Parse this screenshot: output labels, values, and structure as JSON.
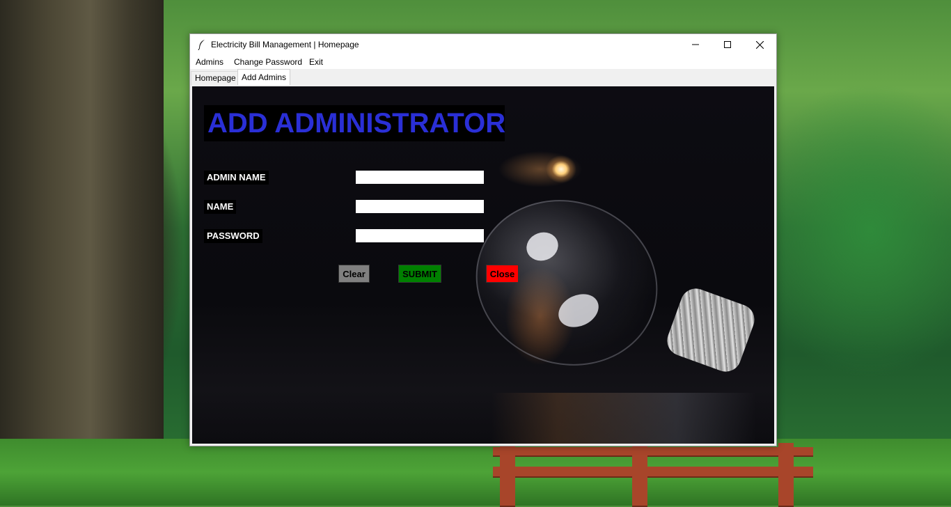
{
  "window": {
    "title": "Electricity Bill Management | Homepage",
    "controls": {
      "minimize": "—",
      "maximize": "☐",
      "close": "✕"
    }
  },
  "menubar": {
    "items": [
      {
        "label": "Admins"
      },
      {
        "label": "Change Password"
      },
      {
        "label": "Exit"
      }
    ]
  },
  "tabs": [
    {
      "label": "Homepage",
      "active": false
    },
    {
      "label": "Add Admins",
      "active": true
    }
  ],
  "form": {
    "heading": "ADD ADMINISTRATOR",
    "fields": [
      {
        "label": "ADMIN NAME",
        "value": ""
      },
      {
        "label": "NAME",
        "value": ""
      },
      {
        "label": "PASSWORD",
        "value": ""
      }
    ],
    "buttons": {
      "clear": "Clear",
      "submit": "SUBMIT",
      "close": "Close"
    }
  },
  "colors": {
    "heading": "#2a2fd6",
    "clear_bg": "#808080",
    "submit_bg": "#008000",
    "close_bg": "#ff0000"
  }
}
